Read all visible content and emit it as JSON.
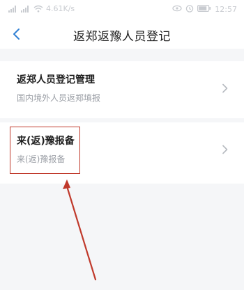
{
  "status_bar": {
    "network_speed": "4.61K/s",
    "time": "12:57",
    "icons": [
      "signal-icon",
      "signal-icon",
      "wifi-icon",
      "eye-icon",
      "alarm-icon",
      "battery-icon"
    ]
  },
  "nav": {
    "title": "返郑返豫人员登记"
  },
  "cards": [
    {
      "title": "返郑人员登记管理",
      "subtitle": "国内境外人员返郑填报"
    },
    {
      "title": "来(返)豫报备",
      "subtitle": "来(返)豫报备"
    }
  ],
  "colors": {
    "annotation": "#c0392b",
    "background": "#f5f6f8",
    "accent": "#2f7fd4"
  }
}
